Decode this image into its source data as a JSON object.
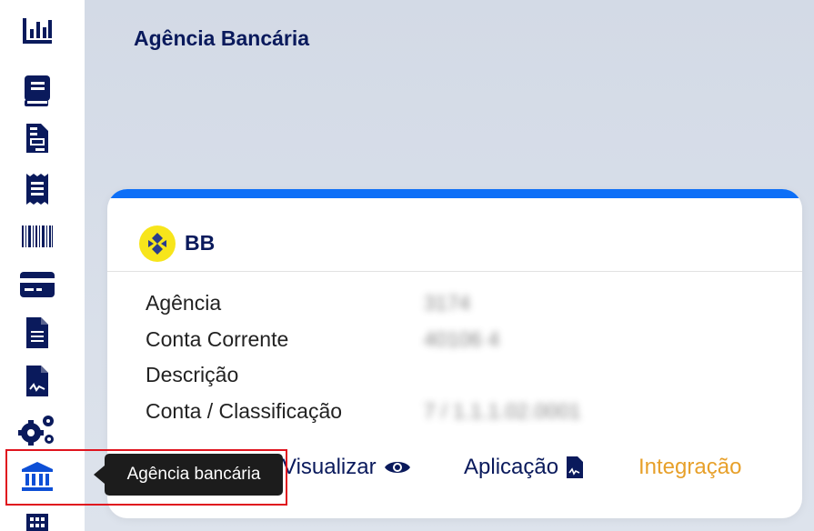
{
  "page": {
    "title": "Agência Bancária"
  },
  "sidebar": {
    "items": [
      {
        "name": "chart-icon"
      },
      {
        "name": "book-icon"
      },
      {
        "name": "invoice-icon"
      },
      {
        "name": "receipt-icon"
      },
      {
        "name": "barcode-icon"
      },
      {
        "name": "credit-card-icon"
      },
      {
        "name": "document-icon"
      },
      {
        "name": "signature-document-icon"
      },
      {
        "name": "gears-icon"
      },
      {
        "name": "bank-icon",
        "active": true
      },
      {
        "name": "building-icon"
      }
    ]
  },
  "tooltip": {
    "text": "Agência bancária"
  },
  "card": {
    "bank_name": "BB",
    "fields": [
      {
        "label": "Agência",
        "value": "3174"
      },
      {
        "label": "Conta Corrente",
        "value": "40106 4"
      },
      {
        "label": "Descrição",
        "value": ""
      },
      {
        "label": "Conta / Classificação",
        "value": "7 / 1.1.1.02.0001"
      }
    ],
    "actions": {
      "view": "Visualizar",
      "application": "Aplicação",
      "integration": "Integração"
    }
  },
  "colors": {
    "navy": "#0a1a5c",
    "accent_blue": "#0d6ff7",
    "integration_orange": "#e7a02a",
    "bank_logo_yellow": "#f7e51b",
    "highlight_red": "#e0141e"
  }
}
